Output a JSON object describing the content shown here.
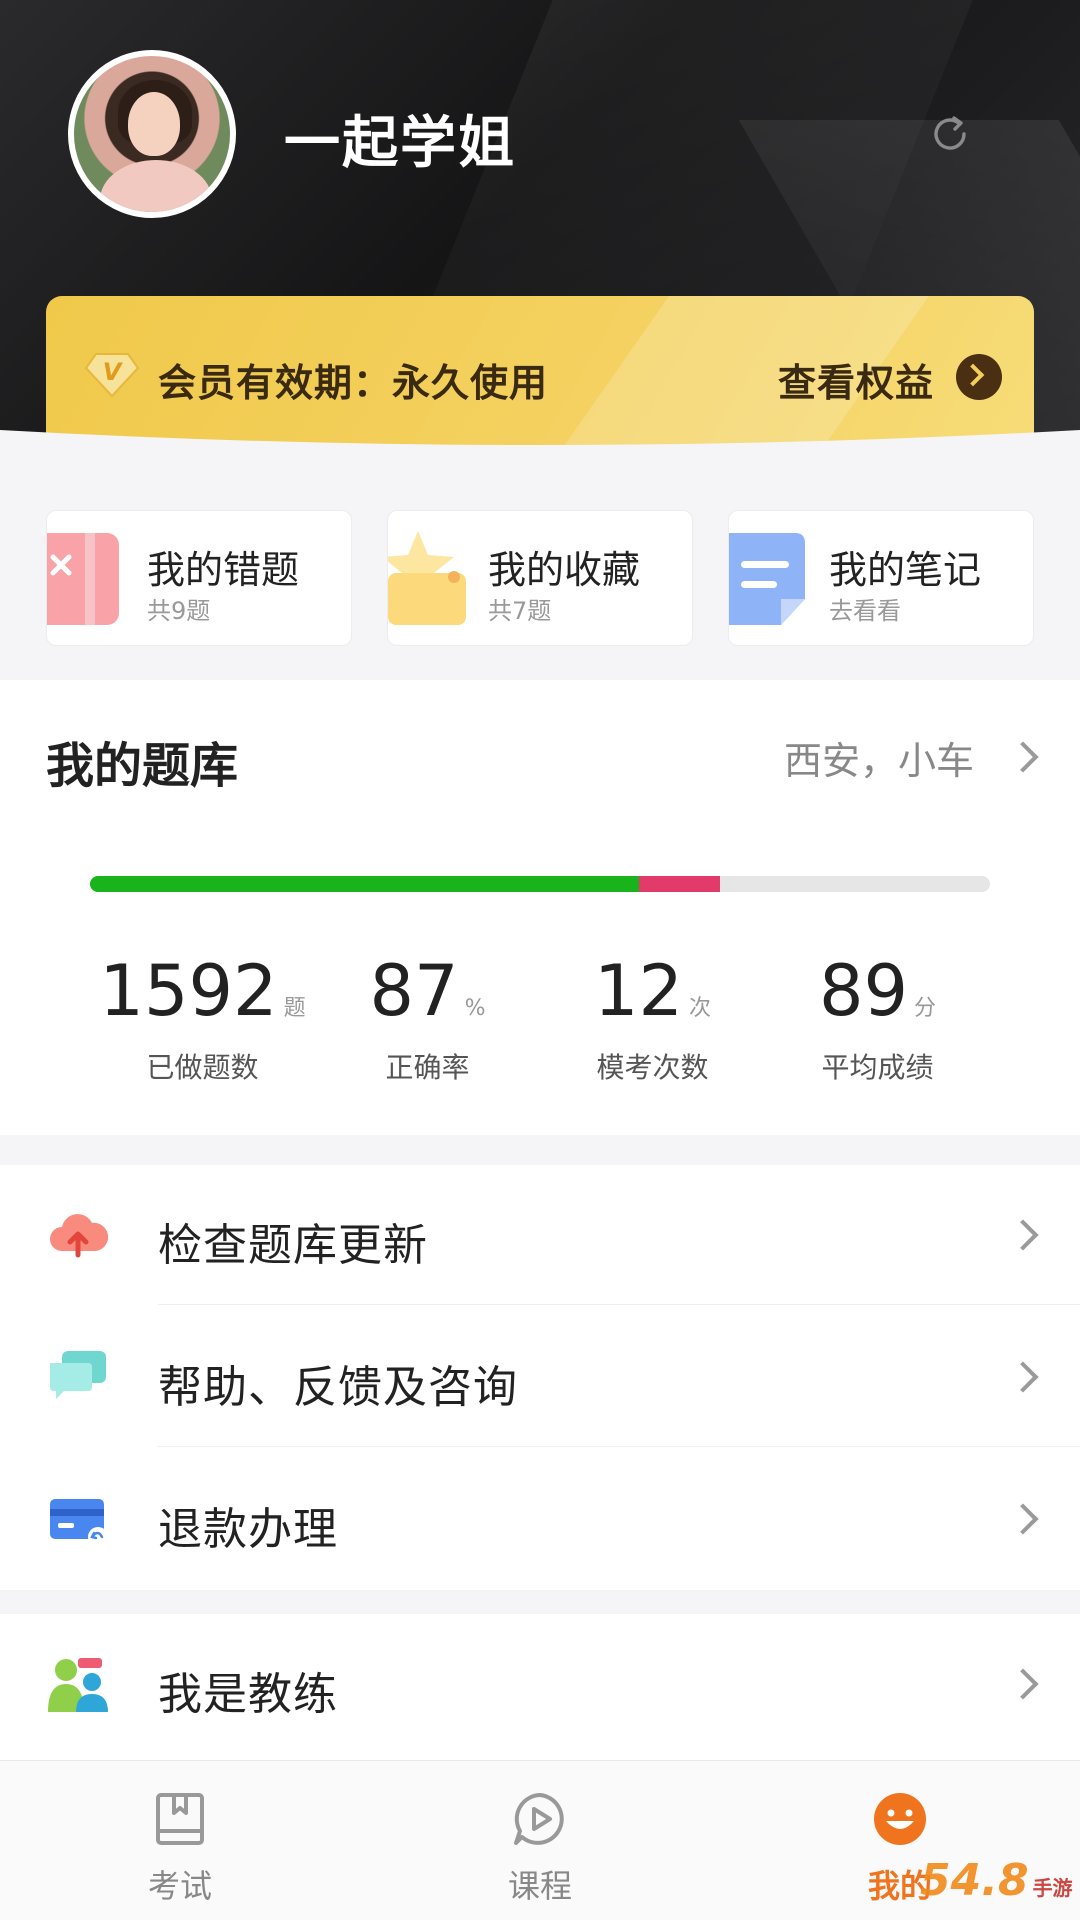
{
  "profile": {
    "username": "一起学姐",
    "refresh_icon": "refresh-icon"
  },
  "vip": {
    "status_text": "会员有效期：永久使用",
    "link_label": "查看权益",
    "badge_letter": "V"
  },
  "quick_cards": [
    {
      "title": "我的错题",
      "sub": "共9题",
      "icon": "wrong-questions-icon"
    },
    {
      "title": "我的收藏",
      "sub": "共7题",
      "icon": "favorites-star-icon"
    },
    {
      "title": "我的笔记",
      "sub": "去看看",
      "icon": "notes-icon"
    }
  ],
  "bank": {
    "title": "我的题库",
    "location": "西安，小车",
    "progress": {
      "correct_fraction": 0.61,
      "wrong_fraction": 0.09
    },
    "stats": [
      {
        "value": "1592",
        "unit": "题",
        "label": "已做题数"
      },
      {
        "value": "87",
        "unit": "%",
        "label": "正确率"
      },
      {
        "value": "12",
        "unit": "次",
        "label": "模考次数"
      },
      {
        "value": "89",
        "unit": "分",
        "label": "平均成绩"
      }
    ]
  },
  "menu": [
    {
      "label": "检查题库更新",
      "icon": "cloud-upload-icon"
    },
    {
      "label": "帮助、反馈及咨询",
      "icon": "chat-bubbles-icon"
    },
    {
      "label": "退款办理",
      "icon": "refund-card-icon"
    }
  ],
  "menu2": [
    {
      "label": "我是教练",
      "icon": "coach-users-icon"
    }
  ],
  "tabs": [
    {
      "label": "考试",
      "icon": "exam-book-icon",
      "active": false
    },
    {
      "label": "课程",
      "icon": "course-play-icon",
      "active": false
    },
    {
      "label": "我的",
      "icon": "smiley-face-icon",
      "active": true
    }
  ],
  "watermark": {
    "text": "54.8",
    "sub": "手游网"
  },
  "colors": {
    "progress_correct": "#19b31b",
    "progress_wrong": "#e23a6a",
    "vip_gold": "#f0c94a",
    "accent_orange": "#f0741e"
  }
}
